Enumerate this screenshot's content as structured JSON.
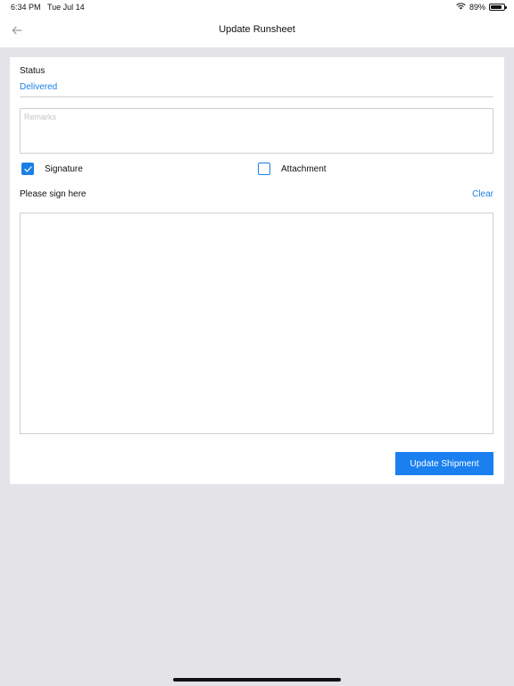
{
  "status_bar": {
    "time": "6:34 PM",
    "date": "Tue Jul 14",
    "battery_text": "89%",
    "battery_level": 0.89
  },
  "nav": {
    "title": "Update Runsheet",
    "back_icon": "arrow-left-icon"
  },
  "form": {
    "status_label": "Status",
    "status_value": "Delivered",
    "remarks_placeholder": "Remarks",
    "remarks_value": "",
    "signature_label": "Signature",
    "signature_checked": true,
    "attachment_label": "Attachment",
    "attachment_checked": false,
    "sign_prompt": "Please sign here",
    "clear_label": "Clear",
    "submit_label": "Update Shipment"
  },
  "colors": {
    "accent": "#1a80e6",
    "background": "#e3e3e8",
    "card": "#ffffff"
  }
}
